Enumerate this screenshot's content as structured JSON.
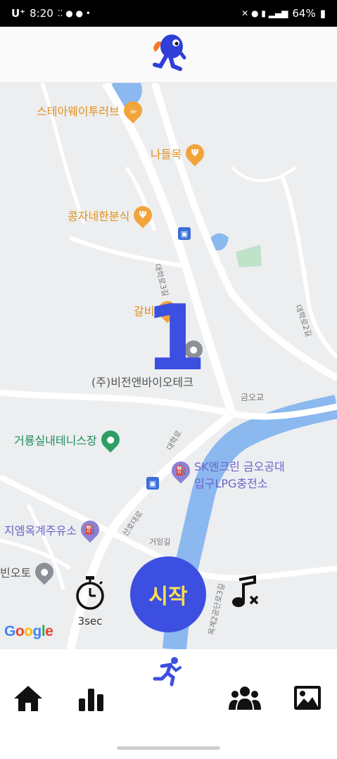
{
  "status_bar": {
    "carrier": "U⁺",
    "time": "8:20",
    "battery": "64%"
  },
  "map": {
    "pois": {
      "stayway": "스테아웨이투러브",
      "nadeulmok": "나들목",
      "kongja": "콩자네한분식",
      "galbi": "갈비",
      "vision": "(주)비전앤바이오테크",
      "tennis": "거룡실내테니스장",
      "sk_line1": "SK엔크린 금오공대",
      "sk_line2": "입구LPG충전소",
      "jiyeom": "지엠옥계주유소",
      "auto": "빈오토"
    },
    "roads": {
      "daehak3": "대학로3길",
      "daehak2": "대학로2길",
      "geumogyo": "금오교",
      "daehakro": "대학로",
      "sanho": "산호대로",
      "geoeong": "거잉길",
      "okgye": "옥계2공단로3길"
    }
  },
  "countdown": "1",
  "controls": {
    "timer_label": "3sec",
    "start_label": "시작"
  },
  "google_logo": {
    "g1": "G",
    "o1": "o",
    "o2": "o",
    "g2": "g",
    "l": "l",
    "e": "e"
  },
  "colors": {
    "accent": "#3d4fe0",
    "start_text": "#ffe14d",
    "food_poi": "#e3901c",
    "river": "#7ab0ef"
  },
  "icons": {
    "logo": "running-mascot-icon",
    "timer": "stopwatch-icon",
    "music": "music-off-icon",
    "nav": [
      "home-icon",
      "stats-icon",
      "run-icon",
      "group-icon",
      "gallery-icon"
    ]
  }
}
